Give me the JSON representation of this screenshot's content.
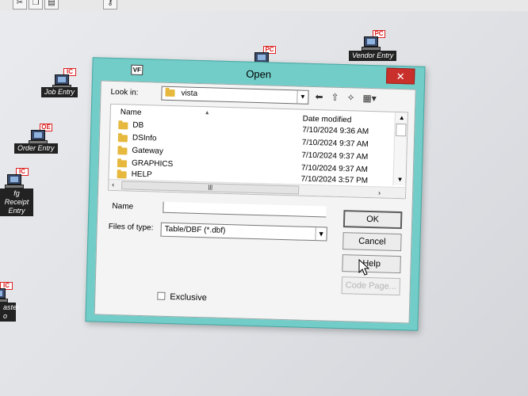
{
  "toolbar": {
    "icons": [
      "scissors-icon",
      "copy-icon",
      "paste-icon",
      "key-icon"
    ]
  },
  "desktop": {
    "icons": [
      {
        "id": "vendor-entry",
        "badge": "PC",
        "label": "Vendor Entry"
      },
      {
        "id": "pc-icon-top",
        "badge": "PC",
        "label": ""
      },
      {
        "id": "job-entry",
        "badge": "IC",
        "label": "Job Entry"
      },
      {
        "id": "order-entry",
        "badge": "OE",
        "label": "Order Entry"
      },
      {
        "id": "receipt-entry",
        "badge": "IC",
        "label_line1": "fg Receipt",
        "label_line2": "Entry"
      },
      {
        "id": "master",
        "badge": "IC",
        "label_line1": "aster",
        "label_line2": "o"
      }
    ]
  },
  "dialog": {
    "app_icon_text": "VF",
    "title": "Open",
    "close_label": "✕",
    "look_in_label": "Look in:",
    "look_in_value": "vista",
    "columns": {
      "name": "Name",
      "date": "Date modified"
    },
    "files": [
      {
        "name": "DB",
        "date": "7/10/2024 9:36 AM"
      },
      {
        "name": "DSInfo",
        "date": "7/10/2024 9:37 AM"
      },
      {
        "name": "Gateway",
        "date": "7/10/2024 9:37 AM"
      },
      {
        "name": "GRAPHICS",
        "date": "7/10/2024 9:37 AM"
      },
      {
        "name": "HELP",
        "date": "7/10/2024 3:57 PM"
      }
    ],
    "name_label": "Name",
    "name_value": "",
    "type_label": "Files of type:",
    "type_value": "Table/DBF (*.dbf)",
    "buttons": {
      "ok": "OK",
      "cancel": "Cancel",
      "help": "Help",
      "code_page": "Code Page..."
    },
    "exclusive_label": "Exclusive"
  }
}
